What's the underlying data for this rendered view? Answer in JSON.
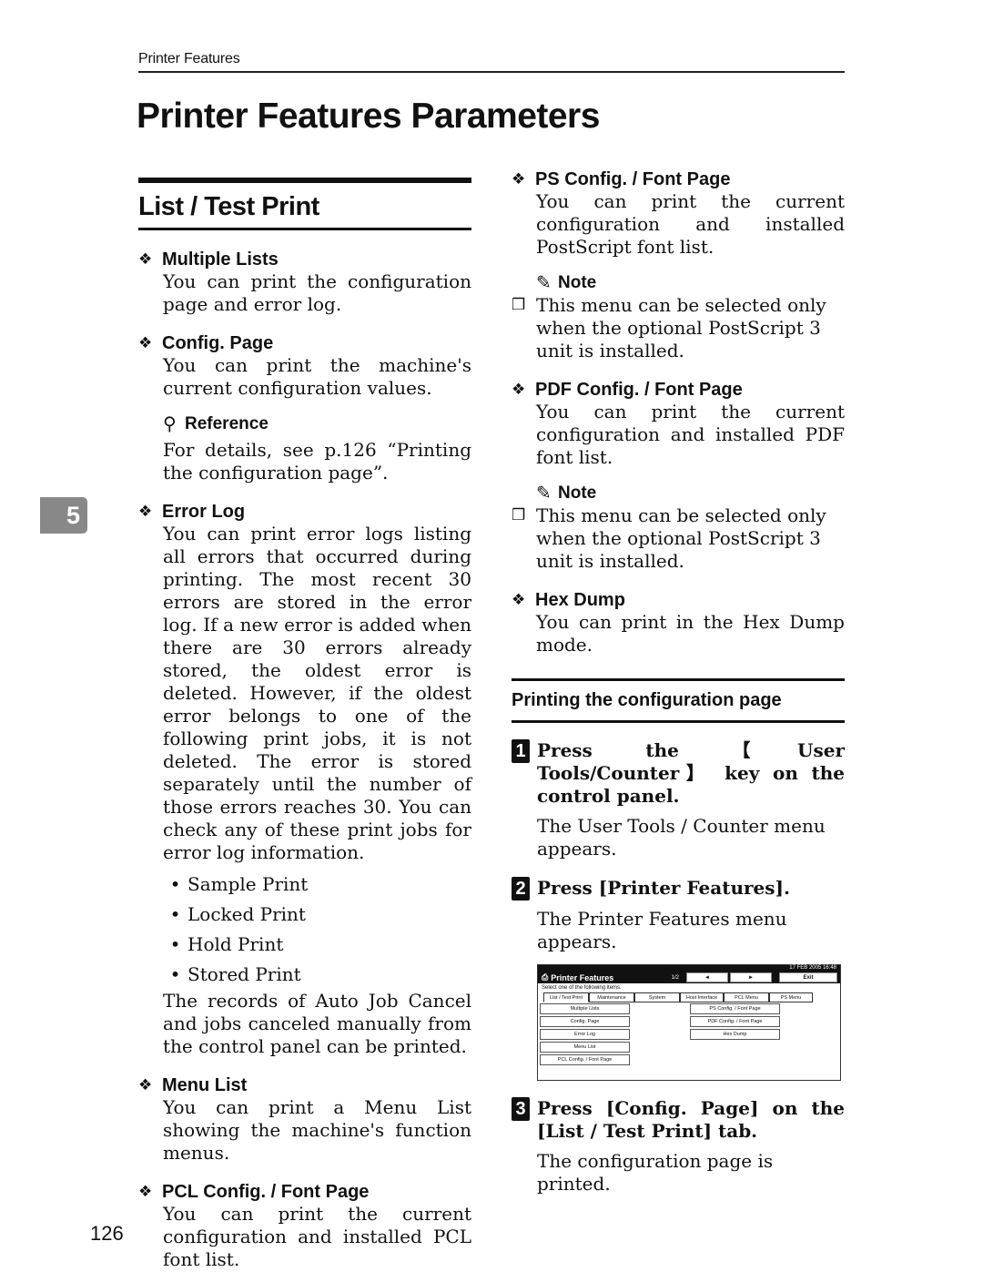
{
  "running_head": "Printer Features",
  "page_title": "Printer Features Parameters",
  "chapter_tab": "5",
  "page_number": "126",
  "section": {
    "title": "List / Test Print",
    "items_left": [
      {
        "title": "Multiple Lists",
        "body": "You can print the configuration page and error log."
      },
      {
        "title": "Config. Page",
        "body": "You can print the machine's current configuration values."
      }
    ],
    "reference": {
      "label": "Reference",
      "text": "For details, see p.126 “Printing the configuration page”."
    },
    "error_log": {
      "title": "Error Log",
      "body": "You can print error logs listing all errors that occurred during printing. The most recent 30 errors are stored in the error log. If a new error is added when there are 30 errors already stored, the oldest error is deleted. However, if the oldest error belongs to one of the following print jobs, it is not deleted. The error is stored separately until the number of those errors reaches 30. You can check any of these print jobs for error log information.",
      "bullets": [
        "Sample Print",
        "Locked Print",
        "Hold Print",
        "Stored Print"
      ],
      "after": "The records of Auto Job Cancel and jobs canceled manually from the control panel can be printed."
    },
    "items_left_2": [
      {
        "title": "Menu List",
        "body": "You can print a Menu List showing the machine's function menus."
      },
      {
        "title": "PCL Config. / Font Page",
        "body": "You can print the current configuration and installed PCL font list."
      }
    ],
    "ps": {
      "title": "PS Config. / Font Page",
      "body": "You can print the current configuration and installed PostScript font list."
    },
    "note1": {
      "label": "Note",
      "text": "This menu can be selected only when the optional PostScript 3 unit is installed."
    },
    "pdf": {
      "title": "PDF Config. / Font Page",
      "body": "You can print the current configuration and installed PDF font list."
    },
    "note2": {
      "label": "Note",
      "text": "This menu can be selected only when the optional PostScript 3 unit is installed."
    },
    "hex": {
      "title": "Hex Dump",
      "body": "You can print in the Hex Dump mode."
    }
  },
  "procedure": {
    "title": "Printing the configuration page",
    "steps": [
      {
        "num": "1",
        "text": "Press the 【User Tools/Counter】 key on the control panel.",
        "desc": "The User Tools / Counter menu appears."
      },
      {
        "num": "2",
        "text": "Press [Printer Features].",
        "desc": "The Printer Features menu appears."
      },
      {
        "num": "3",
        "text": "Press [Config. Page] on the [List / Test Print] tab.",
        "desc": "The configuration page is printed."
      }
    ]
  },
  "screen": {
    "datetime": "17 FEB  2005 16:48",
    "title": "Printer Features",
    "page": "1/2",
    "prev": "◄",
    "next": "►",
    "exit": "Exit",
    "message": "Select one of the following items.",
    "tabs": [
      "List / Test Print",
      "Maintenance",
      "System",
      "Host Interface",
      "PCL Menu",
      "PS Menu"
    ],
    "left_items": [
      "Multiple Lists",
      "Config. Page",
      "Error Log",
      "Menu List",
      "PCL Config. / Font Page"
    ],
    "right_items": [
      "PS Config. / Font Page",
      "PDF Config. / Font Page",
      "Hex Dump"
    ]
  }
}
